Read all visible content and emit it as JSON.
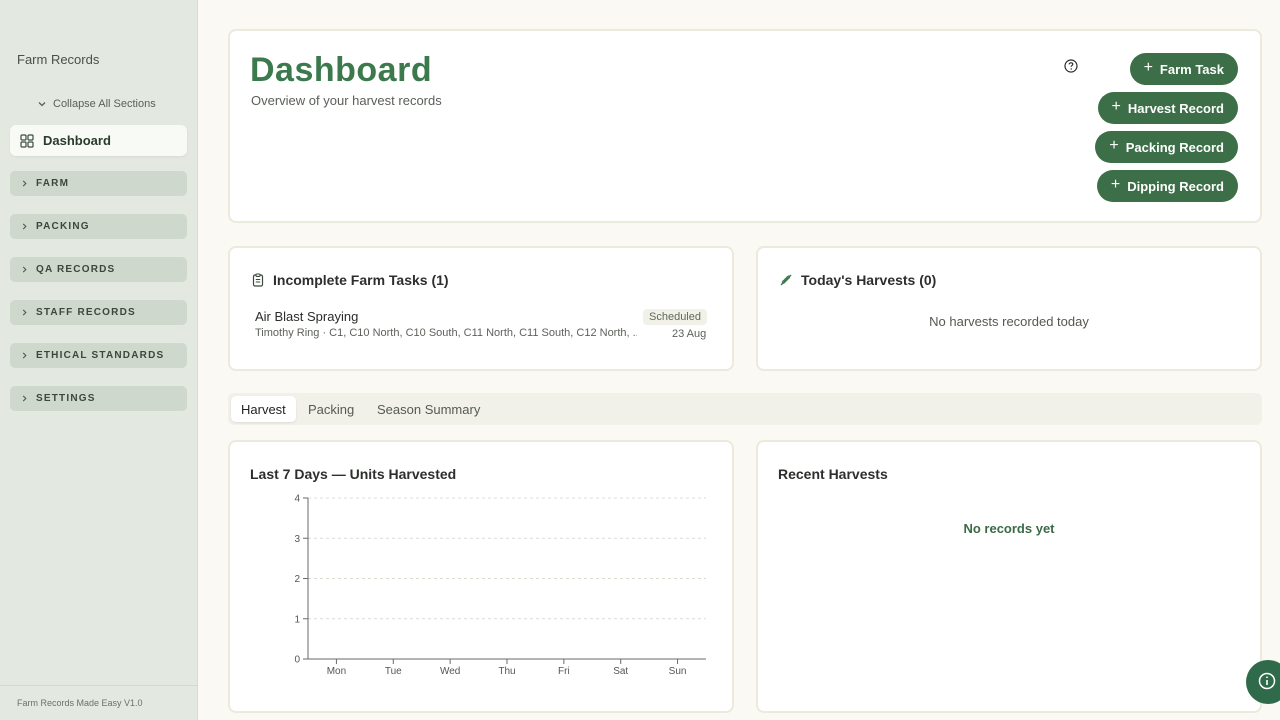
{
  "sidebar": {
    "brand": "Farm Records",
    "collapse_label": "Collapse All Sections",
    "dashboard_label": "Dashboard",
    "sections": [
      "FARM",
      "PACKING",
      "QA RECORDS",
      "STAFF RECORDS",
      "ETHICAL STANDARDS",
      "SETTINGS"
    ],
    "footer": "Farm Records Made Easy V1.0"
  },
  "header": {
    "title": "Dashboard",
    "subtitle": "Overview of your harvest records",
    "buttons": [
      "Farm Task",
      "Harvest Record",
      "Packing Record",
      "Dipping Record"
    ]
  },
  "tasks": {
    "title": "Incomplete Farm Tasks (1)",
    "items": [
      {
        "name": "Air Blast Spraying",
        "detail": "Timothy Ring · C1, C10 North, C10 South, C11 North, C11 South, C12 North, ...",
        "status": "Scheduled",
        "date": "23 Aug"
      }
    ]
  },
  "harvests": {
    "title": "Today's Harvests (0)",
    "empty": "No harvests recorded today"
  },
  "tabs": [
    "Harvest",
    "Packing",
    "Season Summary"
  ],
  "active_tab": 0,
  "chart": {
    "title": "Last 7 Days — Units Harvested"
  },
  "recent": {
    "title": "Recent Harvests",
    "empty": "No records yet"
  },
  "colors": {
    "brand_green": "#3c7a4e",
    "button_green": "#3c6e48",
    "sidebar_bg": "#e3e9e1"
  },
  "chart_data": {
    "type": "line",
    "title": "Last 7 Days — Units Harvested",
    "categories": [
      "Mon",
      "Tue",
      "Wed",
      "Thu",
      "Fri",
      "Sat",
      "Sun"
    ],
    "series": [],
    "y_ticks": [
      0,
      1,
      2,
      3,
      4
    ],
    "ylim": [
      0,
      4
    ],
    "grid": true
  }
}
